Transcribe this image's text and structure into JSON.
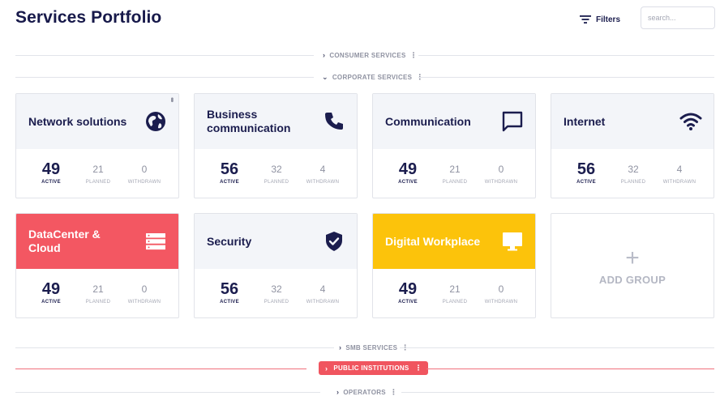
{
  "header": {
    "title": "Services Portfolio",
    "filters_label": "Filters",
    "search_placeholder": "search..."
  },
  "sections": {
    "consumer": "CONSUMER SERVICES",
    "corporate": "CORPORATE SERVICES",
    "smb": "SMB SERVICES",
    "public": "PUBLIC INSTITUTIONS",
    "operators": "OPERATORS"
  },
  "stat_labels": {
    "active": "ACTIVE",
    "planned": "PLANNED",
    "withdrawn": "WITHDRAWN"
  },
  "cards": [
    {
      "name": "Network solutions",
      "icon": "globe-icon",
      "active": "49",
      "planned": "21",
      "withdrawn": "0"
    },
    {
      "name": "Business communication",
      "icon": "phone-icon",
      "active": "56",
      "planned": "32",
      "withdrawn": "4"
    },
    {
      "name": "Communication",
      "icon": "chat-icon",
      "active": "49",
      "planned": "21",
      "withdrawn": "0"
    },
    {
      "name": "Internet",
      "icon": "wifi-icon",
      "active": "56",
      "planned": "32",
      "withdrawn": "4"
    },
    {
      "name": "DataCenter & Cloud",
      "icon": "server-icon",
      "active": "49",
      "planned": "21",
      "withdrawn": "0"
    },
    {
      "name": "Security",
      "icon": "shield-check-icon",
      "active": "56",
      "planned": "32",
      "withdrawn": "4"
    },
    {
      "name": "Digital Workplace",
      "icon": "monitor-icon",
      "active": "49",
      "planned": "21",
      "withdrawn": "0"
    }
  ],
  "add_group_label": "ADD GROUP",
  "colors": {
    "navy": "#1b1d4e",
    "red": "#f35762",
    "yellow": "#fcc30b",
    "muted": "#8f92a1"
  }
}
